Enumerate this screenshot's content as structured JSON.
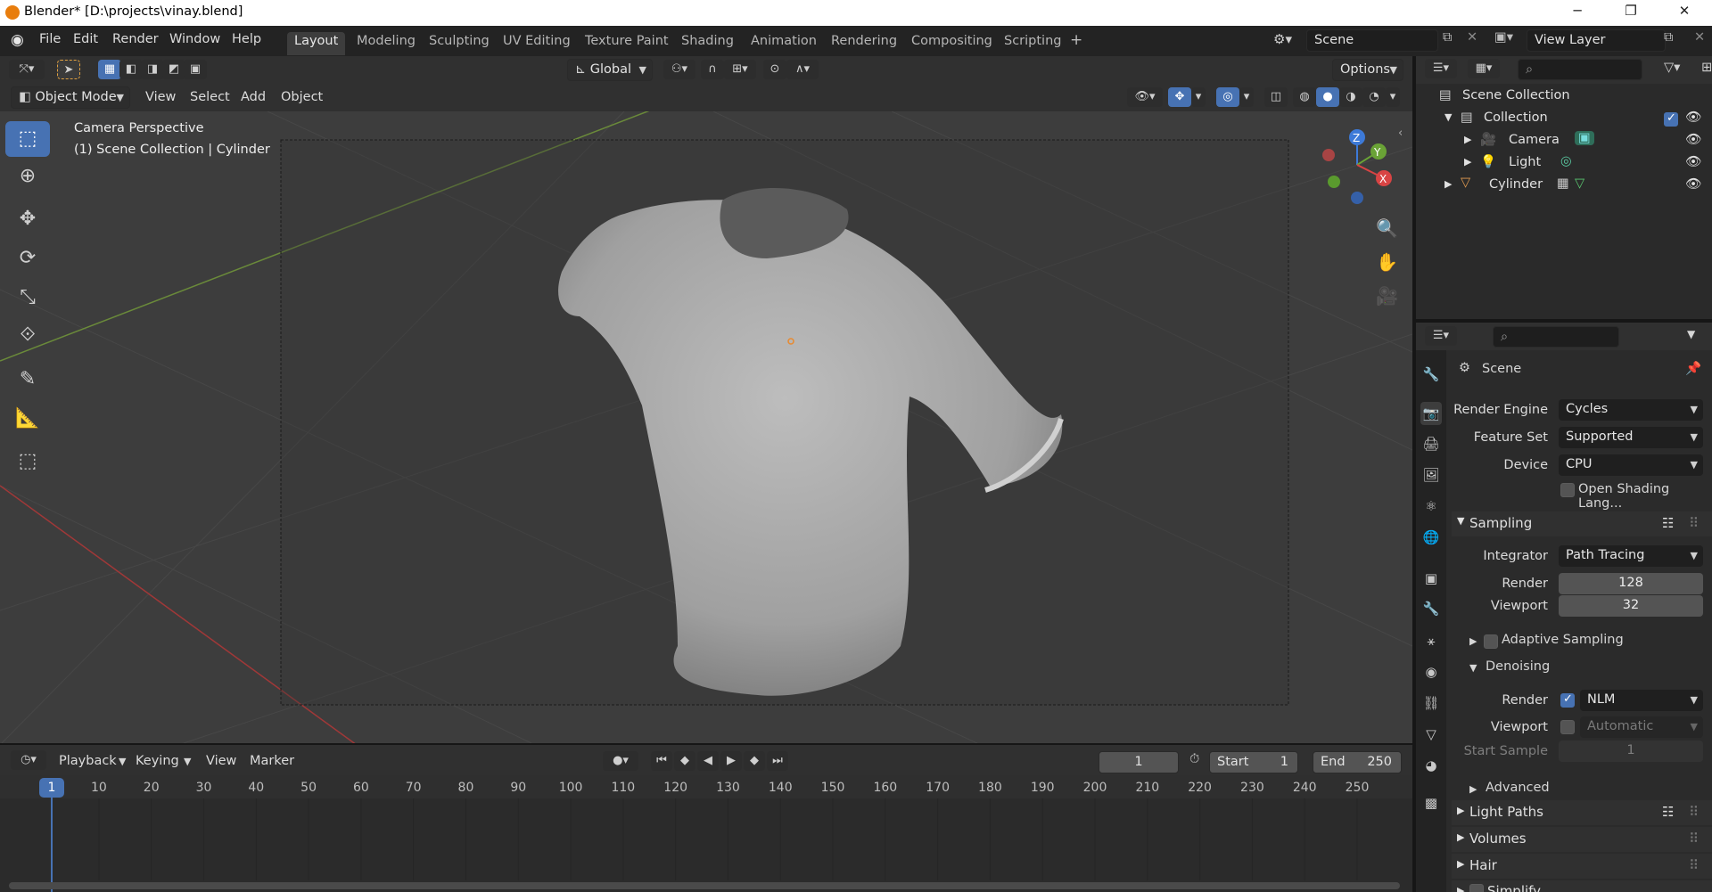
{
  "window": {
    "title": "Blender* [D:\\projects\\vinay.blend]",
    "minimize": "─",
    "maximize": "❐",
    "close": "✕"
  },
  "menu": [
    "File",
    "Edit",
    "Render",
    "Window",
    "Help"
  ],
  "workspaces": [
    "Layout",
    "Modeling",
    "Sculpting",
    "UV Editing",
    "Texture Paint",
    "Shading",
    "Animation",
    "Rendering",
    "Compositing",
    "Scripting"
  ],
  "active_workspace": "Layout",
  "add_workspace": "+",
  "scene_name": "Scene",
  "view_layer": "View Layer",
  "viewport_header": {
    "transform_orientation": "Global",
    "options": "Options"
  },
  "viewport_header2": {
    "mode": "Object Mode",
    "menus": [
      "View",
      "Select",
      "Add",
      "Object"
    ]
  },
  "overlay": {
    "line1": "Camera Perspective",
    "line2": "(1) Scene Collection | Cylinder"
  },
  "gizmo": {
    "x": "X",
    "y": "Y",
    "z": "Z"
  },
  "timeline": {
    "menus": [
      "Playback",
      "Keying",
      "View",
      "Marker"
    ],
    "current_frame": "1",
    "start_label": "Start",
    "start": "1",
    "end_label": "End",
    "end": "250",
    "ticks": [
      "1",
      "10",
      "20",
      "30",
      "40",
      "50",
      "60",
      "70",
      "80",
      "90",
      "100",
      "110",
      "120",
      "130",
      "140",
      "150",
      "160",
      "170",
      "180",
      "190",
      "200",
      "210",
      "220",
      "230",
      "240",
      "250"
    ]
  },
  "outliner": {
    "root": "Scene Collection",
    "collection": "Collection",
    "items": [
      "Camera",
      "Light",
      "Cylinder"
    ]
  },
  "properties": {
    "context": "Scene",
    "render_engine_label": "Render Engine",
    "render_engine": "Cycles",
    "feature_set_label": "Feature Set",
    "feature_set": "Supported",
    "device_label": "Device",
    "device": "CPU",
    "osl_label": "Open Shading Lang...",
    "sampling": "Sampling",
    "integrator_label": "Integrator",
    "integrator": "Path Tracing",
    "render_label": "Render",
    "render_samples": "128",
    "viewport_label": "Viewport",
    "viewport_samples": "32",
    "adaptive": "Adaptive Sampling",
    "denoising": "Denoising",
    "den_render_label": "Render",
    "den_render": "NLM",
    "den_viewport_label": "Viewport",
    "den_viewport": "Automatic",
    "start_sample_label": "Start Sample",
    "start_sample": "1",
    "advanced": "Advanced",
    "light_paths": "Light Paths",
    "volumes": "Volumes",
    "hair": "Hair",
    "simplify": "Simplify"
  }
}
